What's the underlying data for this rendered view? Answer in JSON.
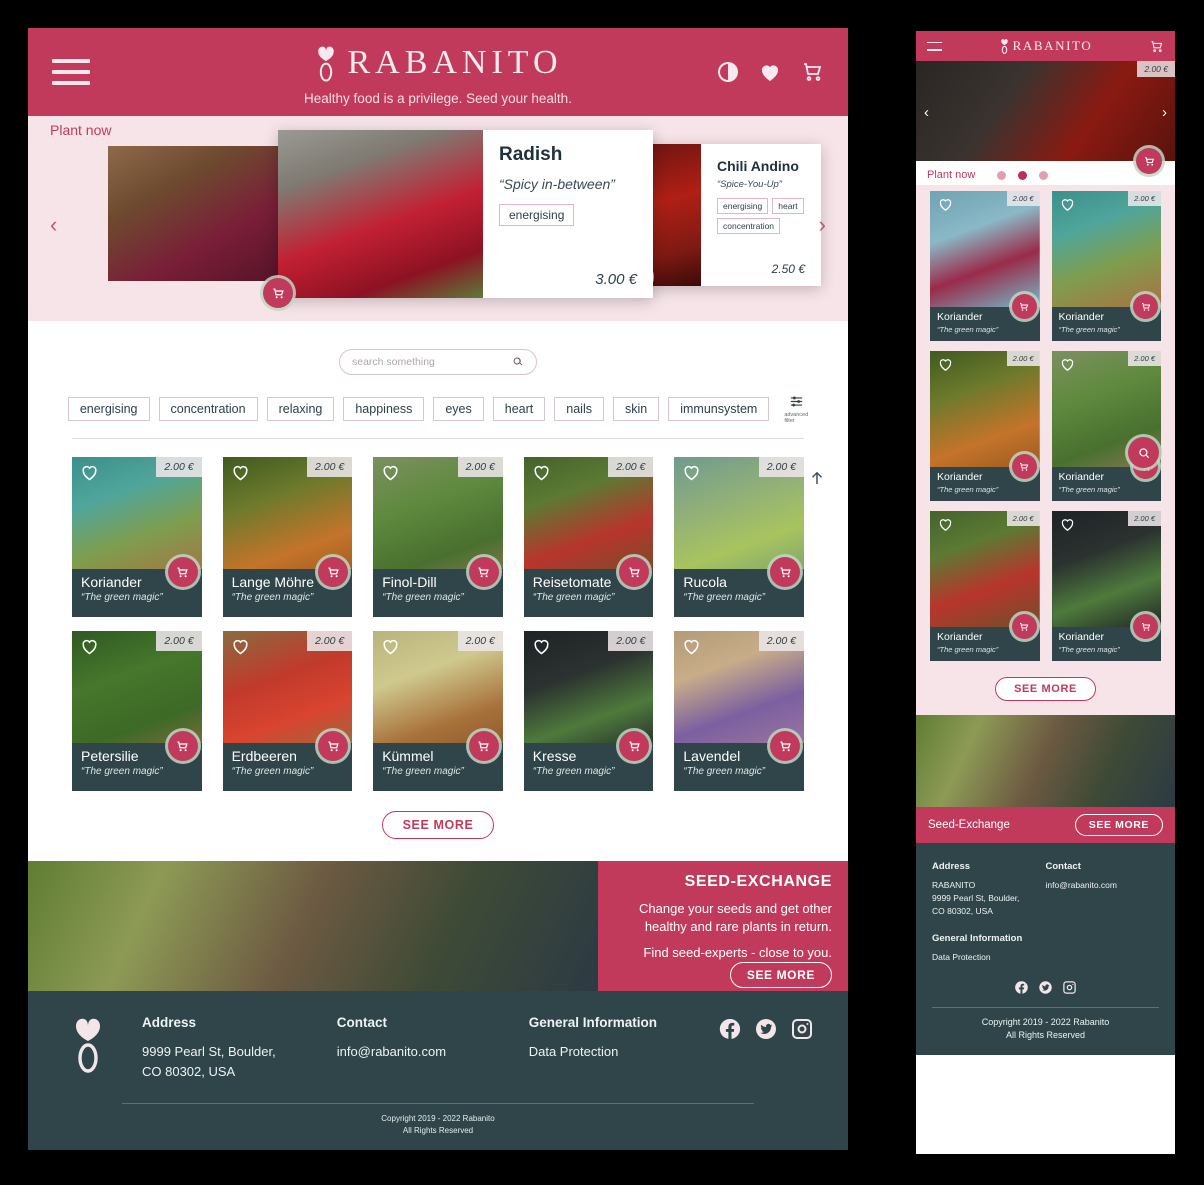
{
  "brand": {
    "name": "RABANITO",
    "tagline": "Healthy food is a privilege. Seed your health.",
    "accent": "#c13a5c",
    "dark": "#2f4549",
    "hero_bg": "#f6e4e8"
  },
  "header": {
    "menu_icon": "hamburger-icon",
    "contrast_icon": "contrast-icon",
    "favourites_icon": "heart-icon",
    "cart_icon": "cart-icon"
  },
  "hero": {
    "label": "Plant now",
    "prev": "‹",
    "next": "›",
    "cards": [
      {
        "title": "Radish",
        "subtitle": "“Spicy in-between”",
        "tags": [
          "energising"
        ],
        "price": "3.00 €"
      },
      {
        "title": "Chili Andino",
        "subtitle": "“Spice-You-Up”",
        "tags": [
          "energising",
          "heart",
          "concentration"
        ],
        "price": "2.50 €"
      }
    ]
  },
  "search": {
    "placeholder": "search something",
    "value": "",
    "icon": "search-icon"
  },
  "filters": {
    "chips": [
      "energising",
      "concentration",
      "relaxing",
      "happiness",
      "eyes",
      "heart",
      "nails",
      "skin",
      "immunsystem"
    ],
    "advanced_label": "advanced filter"
  },
  "grid": {
    "scroll_top_icon": "arrow-up-icon",
    "products": [
      {
        "name": "Koriander",
        "tagline": "“The green magic”",
        "price": "2.00 €"
      },
      {
        "name": "Lange Möhre",
        "tagline": "“The green magic”",
        "price": "2.00 €"
      },
      {
        "name": "Finol-Dill",
        "tagline": "“The green magic”",
        "price": "2.00 €"
      },
      {
        "name": "Reisetomate",
        "tagline": "“The green magic”",
        "price": "2.00 €"
      },
      {
        "name": "Rucola",
        "tagline": "“The green magic”",
        "price": "2.00 €"
      },
      {
        "name": "Petersilie",
        "tagline": "“The green magic”",
        "price": "2.00 €"
      },
      {
        "name": "Erdbeeren",
        "tagline": "“The green magic”",
        "price": "2.00 €"
      },
      {
        "name": "Kümmel",
        "tagline": "“The green magic”",
        "price": "2.00 €"
      },
      {
        "name": "Kresse",
        "tagline": "“The green magic”",
        "price": "2.00 €"
      },
      {
        "name": "Lavendel",
        "tagline": "“The green magic”",
        "price": "2.00 €"
      }
    ],
    "see_more": "SEE MORE"
  },
  "seed_exchange": {
    "title": "SEED-EXCHANGE",
    "line1": "Change your seeds and get other",
    "line2": "healthy and rare plants in return.",
    "line3": "Find seed-experts - close to you.",
    "button": "SEE MORE"
  },
  "footer": {
    "address_heading": "Address",
    "address_line1": "9999 Pearl St, Boulder,",
    "address_line2": "CO 80302, USA",
    "contact_heading": "Contact",
    "contact_email": "info@rabanito.com",
    "info_heading": "General Information",
    "info_link": "Data Protection",
    "copyright_line1": "Copyright 2019 - 2022 Rabanito",
    "copyright_line2": "All Rights Reserved",
    "social": [
      "facebook-icon",
      "twitter-icon",
      "instagram-icon"
    ]
  },
  "mobile": {
    "brand": "RABANITO",
    "hero_price": "2.00 €",
    "plant_now": "Plant now",
    "dots": 3,
    "active_dot": 1,
    "products": [
      {
        "name": "Koriander",
        "tagline": "“The green magic”",
        "price": "2.00 €"
      },
      {
        "name": "Koriander",
        "tagline": "“The green magic”",
        "price": "2.00 €"
      },
      {
        "name": "Koriander",
        "tagline": "“The green magic”",
        "price": "2.00 €"
      },
      {
        "name": "Koriander",
        "tagline": "“The green magic”",
        "price": "2.00 €"
      },
      {
        "name": "Koriander",
        "tagline": "“The green magic”",
        "price": "2.00 €"
      },
      {
        "name": "Koriander",
        "tagline": "“The green magic”",
        "price": "2.00 €"
      }
    ],
    "see_more": "SEE MORE",
    "seed_title": "Seed-Exchange",
    "seed_button": "SEE MORE",
    "footer": {
      "address_heading": "Address",
      "address_line0": "RABANITO",
      "address_line1": "9999 Pearl St, Boulder,",
      "address_line2": "CO 80302, USA",
      "contact_heading": "Contact",
      "contact_email": "info@rabanito.com",
      "info_heading": "General Information",
      "info_link": "Data Protection",
      "copyright_line1": "Copyright 2019 - 2022 Rabanito",
      "copyright_line2": "All Rights Reserved"
    }
  }
}
